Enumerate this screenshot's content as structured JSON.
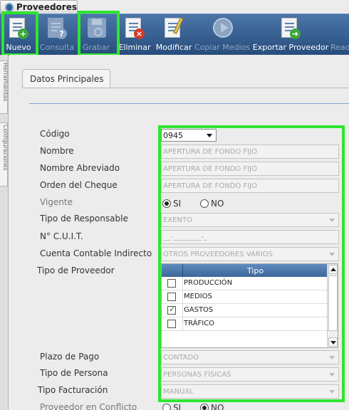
{
  "window": {
    "title": "Proveedores"
  },
  "toolbar": {
    "nuevo": "Nuevo",
    "consulta": "Consulta",
    "grabar": "Grabar",
    "eliminar": "Eliminar",
    "modificar": "Modificar",
    "copiar_medios": "Copiar Medios",
    "exportar": "Exportar Proveedor",
    "read": "Read"
  },
  "side_tabs": [
    "Herramientas",
    "Configuraciones"
  ],
  "tab": {
    "label": "Datos Principales"
  },
  "form": {
    "codigo": {
      "label": "Código",
      "value": "0945"
    },
    "nombre": {
      "label": "Nombre",
      "value": "APERTURA DE FONDO FIJO"
    },
    "nombre_abreviado": {
      "label": "Nombre Abreviado",
      "value": "APERTURA DE FONDO FIJO"
    },
    "orden_cheque": {
      "label": "Orden del Cheque",
      "value": "APERTURA DE FONDO FIJO"
    },
    "vigente": {
      "label": "Vigente",
      "si": "SI",
      "no": "NO",
      "selected": "SI"
    },
    "tipo_responsable": {
      "label": "Tipo de Responsable",
      "value": "EXENTO"
    },
    "cuit": {
      "label": "N° C.U.I.T.",
      "value": "__-________-_"
    },
    "cuenta_contable": {
      "label": "Cuenta Contable Indirecto",
      "value": "OTROS PROVEEDORES VARIOS"
    },
    "tipo_proveedor": {
      "label": "Tipo de Proveedor",
      "column": "Tipo",
      "rows": [
        {
          "text": "PRODUCCIÓN",
          "checked": false
        },
        {
          "text": "MEDIOS",
          "checked": false
        },
        {
          "text": "GASTOS",
          "checked": true
        },
        {
          "text": "TRÁFICO",
          "checked": false
        }
      ]
    },
    "plazo_pago": {
      "label": "Plazo de Pago",
      "value": "CONTADO"
    },
    "tipo_persona": {
      "label": "Tipo de Persona",
      "value": "PERSONAS FÍSICAS"
    },
    "tipo_facturacion": {
      "label": "Tipo Facturación",
      "value": "MANUAL"
    },
    "conflicto": {
      "label": "Proveedor en Conflicto",
      "si": "SI",
      "no": "NO",
      "selected": "NO"
    }
  },
  "colors": {
    "highlight": "#2ee62e",
    "toolbar": "#3a6293",
    "grid_header": "#4b78ad"
  }
}
